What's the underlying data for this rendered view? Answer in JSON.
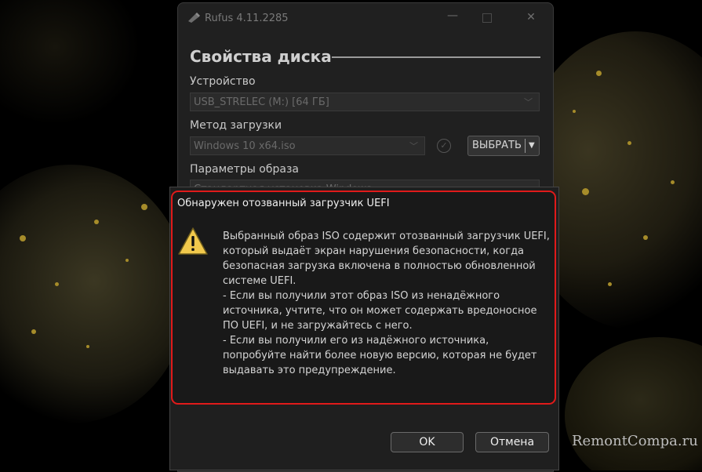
{
  "window": {
    "title": "Rufus 4.11.2285",
    "icon": "usb-drive-icon",
    "minimize_glyph": "—",
    "close_glyph": "✕"
  },
  "drive_properties": {
    "section_title": "Свойства диска",
    "device_label": "Устройство",
    "device_value": "USB_STRELEC (M:) [64 ГБ]",
    "boot_method_label": "Метод загрузки",
    "boot_method_value": "Windows 10 x64.iso",
    "select_button": "ВЫБРАТЬ",
    "image_options_label": "Параметры образа",
    "image_options_value": "Стандартная установка Windows"
  },
  "dialog": {
    "title": "Обнаружен отозванный загрузчик UEFI",
    "icon": "warning-icon",
    "message": "Выбранный образ ISO содержит отозванный загрузчик UEFI, который выдаёт экран нарушения безопасности, когда безопасная загрузка включена в полностью обновленной системе UEFI.",
    "bullet_1": "- Если вы получили этот образ ISO из ненадёжного источника, учтите, что он может содержать вредоносное ПО UEFI, и не загружайтесь с него.",
    "bullet_2": "- Если вы получили его из надёжного источника, попробуйте найти более новую версию, которая не будет выдавать это предупреждение.",
    "ok_button": "OK",
    "cancel_button": "Отмена"
  },
  "watermark": "RemontCompa.ru",
  "colors": {
    "highlight": "#e01a1a",
    "warning": "#f2c94c",
    "wallpaper_gold": "#a68c2a"
  }
}
